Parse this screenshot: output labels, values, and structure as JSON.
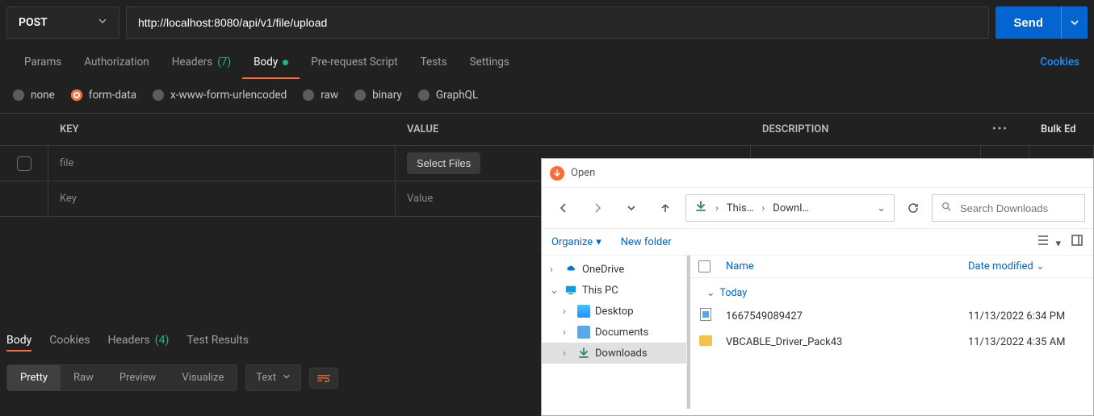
{
  "request": {
    "method": "POST",
    "url": "http://localhost:8080/api/v1/file/upload",
    "send_label": "Send"
  },
  "tabs": {
    "params": "Params",
    "authorization": "Authorization",
    "headers": "Headers",
    "headers_count": "(7)",
    "body": "Body",
    "pre_request": "Pre-request Script",
    "tests": "Tests",
    "settings": "Settings",
    "cookies": "Cookies"
  },
  "body_options": {
    "none": "none",
    "form_data": "form-data",
    "xwww": "x-www-form-urlencoded",
    "raw": "raw",
    "binary": "binary",
    "graphql": "GraphQL"
  },
  "kv": {
    "key_header": "KEY",
    "value_header": "VALUE",
    "desc_header": "DESCRIPTION",
    "bulk_edit": "Bulk Ed",
    "row1_key": "file",
    "select_files_label": "Select Files",
    "key_placeholder": "Key",
    "value_placeholder": "Value"
  },
  "response": {
    "body": "Body",
    "cookies": "Cookies",
    "headers": "Headers",
    "headers_count": "(4)",
    "test_results": "Test Results",
    "pretty": "Pretty",
    "raw": "Raw",
    "preview": "Preview",
    "visualize": "Visualize",
    "text": "Text"
  },
  "dialog": {
    "title": "Open",
    "crumb1": "This…",
    "crumb2": "Downl…",
    "search_placeholder": "Search Downloads",
    "organize": "Organize",
    "new_folder": "New folder",
    "col_name": "Name",
    "col_date": "Date modified",
    "group_today": "Today",
    "tree": {
      "onedrive": "OneDrive",
      "this_pc": "This PC",
      "desktop": "Desktop",
      "documents": "Documents",
      "downloads": "Downloads"
    },
    "files": [
      {
        "name": "1667549089427",
        "date": "11/13/2022 6:34 PM",
        "type": "file"
      },
      {
        "name": "VBCABLE_Driver_Pack43",
        "date": "11/13/2022 4:35 AM",
        "type": "folder"
      }
    ]
  }
}
